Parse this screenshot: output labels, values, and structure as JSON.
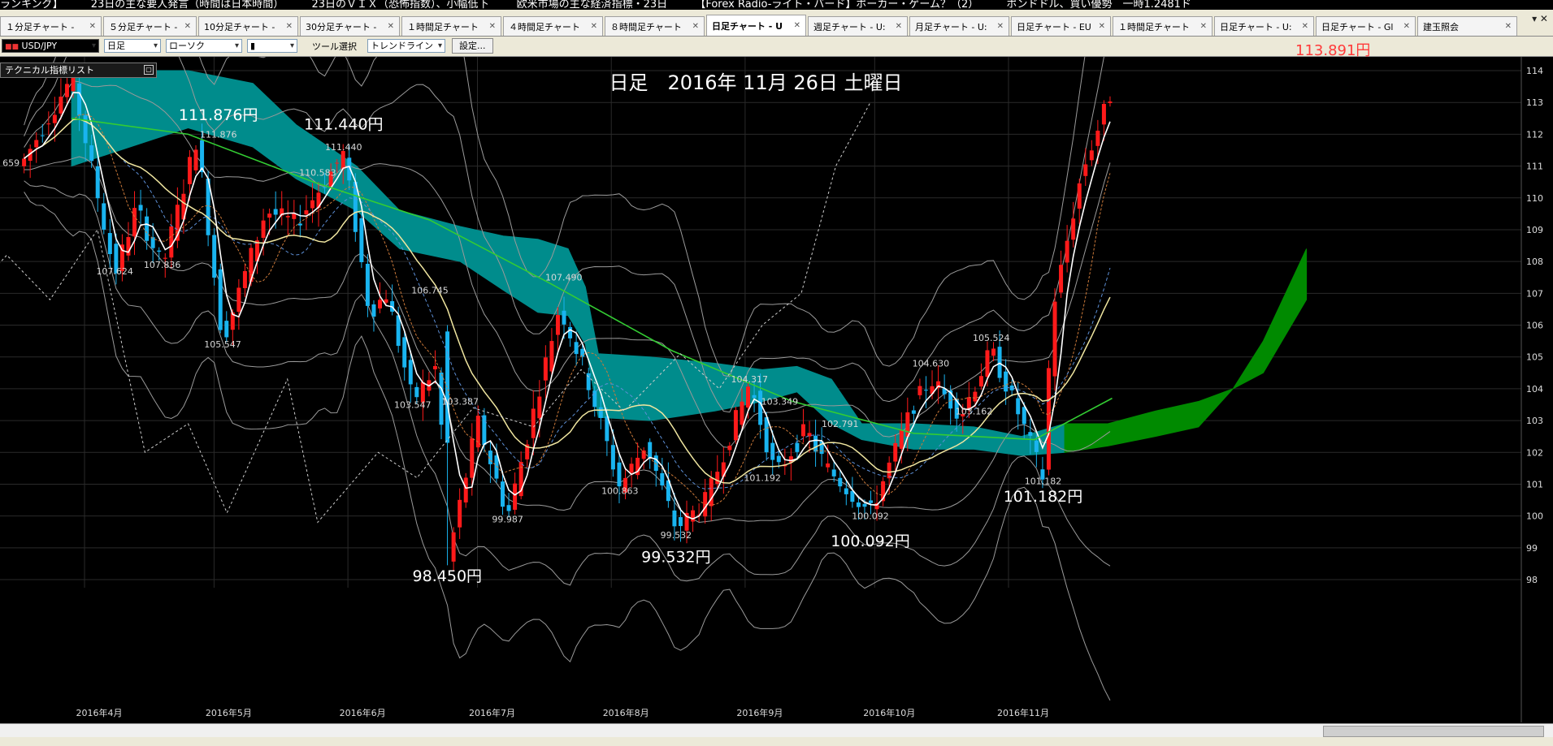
{
  "ticker": {
    "items": [
      "ランキング】",
      "23日の主な要人発言（時間は日本時間）",
      "23日のＶＩＸ（恐怖指数）、小幅低下",
      "欧米市場の主な経済指標・23日",
      "【Forex Radio-ライト・バード】ポーカー・ゲーム？（2）",
      "ポンドドル、買い優勢　一時1.2481ド"
    ]
  },
  "tabs": [
    {
      "label": "１分足チャート -",
      "active": false,
      "w": 125
    },
    {
      "label": "５分足チャート -",
      "active": false,
      "w": 115
    },
    {
      "label": "10分足チャート -",
      "active": false,
      "w": 123
    },
    {
      "label": "30分足チャート -",
      "active": false,
      "w": 123
    },
    {
      "label": "１時間足チャート",
      "active": false,
      "w": 123
    },
    {
      "label": "４時間足チャート",
      "active": false,
      "w": 123
    },
    {
      "label": "８時間足チャート",
      "active": false,
      "w": 123
    },
    {
      "label": "日足チャート - U",
      "active": true,
      "w": 123
    },
    {
      "label": "週足チャート - U:",
      "active": false,
      "w": 123
    },
    {
      "label": "月足チャート - U:",
      "active": false,
      "w": 123
    },
    {
      "label": "日足チャート - EU",
      "active": false,
      "w": 123
    },
    {
      "label": "１時間足チャート",
      "active": false,
      "w": 123
    },
    {
      "label": "日足チャート - U:",
      "active": false,
      "w": 123
    },
    {
      "label": "日足チャート - Gl",
      "active": false,
      "w": 123
    },
    {
      "label": "建玉照会",
      "active": false,
      "w": 123
    }
  ],
  "toolbar": {
    "pair": "USD/JPY",
    "period": "日足",
    "style": "ローソク",
    "tool_label": "ツール選択",
    "tool": "トレンドライン",
    "settings": "設定..."
  },
  "tech_panel": {
    "label": "テクニカル指標リスト"
  },
  "current_price_label": "113.891円",
  "chart_data": {
    "type": "candlestick",
    "pair": "USD/JPY",
    "title": "日足　2016年 11月 26日 土曜日",
    "ylim": [
      98,
      114
    ],
    "y_ticks": [
      98,
      99,
      100,
      101,
      102,
      103,
      104,
      105,
      106,
      107,
      108,
      109,
      110,
      111,
      112,
      113,
      114
    ],
    "x_labels": [
      "2016年4月",
      "2016年5月",
      "2016年6月",
      "2016年7月",
      "2016年8月",
      "2016年9月",
      "2016年10月",
      "2016年11月"
    ],
    "colors": {
      "up": "#ff1a1a",
      "down": "#19b4f0",
      "cloud": "#008c8c",
      "cloud_future": "#008a00"
    },
    "annotations_large": [
      {
        "text": "111.876円",
        "at": "2016-05-02",
        "price": 112.6
      },
      {
        "text": "111.440円",
        "at": "2016-05-31",
        "price": 112.3
      },
      {
        "text": "98.450円",
        "at": "2016-06-24",
        "price": 98.1
      },
      {
        "text": "99.532円",
        "at": "2016-08-16",
        "price": 98.7
      },
      {
        "text": "100.092円",
        "at": "2016-09-30",
        "price": 99.2
      },
      {
        "text": "101.182円",
        "at": "2016-11-09",
        "price": 100.6
      }
    ],
    "annotations_small": [
      {
        "text": "659",
        "at": "2016-03-15",
        "price": 111.1
      },
      {
        "text": "111.876",
        "at": "2016-05-02",
        "price": 112.0
      },
      {
        "text": "110.583",
        "at": "2016-05-25",
        "price": 110.8
      },
      {
        "text": "111.440",
        "at": "2016-05-31",
        "price": 111.6
      },
      {
        "text": "107.624",
        "at": "2016-04-08",
        "price": 107.7
      },
      {
        "text": "107.836",
        "at": "2016-04-19",
        "price": 107.9
      },
      {
        "text": "105.547",
        "at": "2016-05-03",
        "price": 105.4
      },
      {
        "text": "106.745",
        "at": "2016-06-20",
        "price": 107.1
      },
      {
        "text": "107.490",
        "at": "2016-07-21",
        "price": 107.5
      },
      {
        "text": "103.547",
        "at": "2016-06-16",
        "price": 103.5
      },
      {
        "text": "103.387",
        "at": "2016-06-27",
        "price": 103.6
      },
      {
        "text": "99.987",
        "at": "2016-07-08",
        "price": 99.9
      },
      {
        "text": "100.863",
        "at": "2016-08-03",
        "price": 100.8
      },
      {
        "text": "99.532",
        "at": "2016-08-16",
        "price": 99.4
      },
      {
        "text": "104.317",
        "at": "2016-09-02",
        "price": 104.3
      },
      {
        "text": "103.349",
        "at": "2016-09-09",
        "price": 103.6
      },
      {
        "text": "101.192",
        "at": "2016-09-05",
        "price": 101.2
      },
      {
        "text": "102.791",
        "at": "2016-09-23",
        "price": 102.9
      },
      {
        "text": "100.092",
        "at": "2016-09-30",
        "price": 100.0
      },
      {
        "text": "104.630",
        "at": "2016-10-14",
        "price": 104.8
      },
      {
        "text": "103.162",
        "at": "2016-10-24",
        "price": 103.3
      },
      {
        "text": "105.524",
        "at": "2016-10-28",
        "price": 105.6
      },
      {
        "text": "101.182",
        "at": "2016-11-09",
        "price": 101.1
      }
    ],
    "pivots": [
      {
        "date": "2016-03-18",
        "price": 111.2
      },
      {
        "date": "2016-03-29",
        "price": 113.8
      },
      {
        "date": "2016-04-08",
        "price": 107.6
      },
      {
        "date": "2016-04-13",
        "price": 109.7
      },
      {
        "date": "2016-04-19",
        "price": 107.8
      },
      {
        "date": "2016-04-27",
        "price": 111.9
      },
      {
        "date": "2016-05-03",
        "price": 105.5
      },
      {
        "date": "2016-05-13",
        "price": 109.6
      },
      {
        "date": "2016-05-20",
        "price": 109.2
      },
      {
        "date": "2016-05-31",
        "price": 111.4
      },
      {
        "date": "2016-06-06",
        "price": 106.4
      },
      {
        "date": "2016-06-10",
        "price": 107.0
      },
      {
        "date": "2016-06-16",
        "price": 103.6
      },
      {
        "date": "2016-06-22",
        "price": 104.8
      },
      {
        "date": "2016-06-24",
        "price": 98.5
      },
      {
        "date": "2016-07-01",
        "price": 103.0
      },
      {
        "date": "2016-07-08",
        "price": 100.0
      },
      {
        "date": "2016-07-20",
        "price": 106.6
      },
      {
        "date": "2016-07-26",
        "price": 104.5
      },
      {
        "date": "2016-08-03",
        "price": 100.9
      },
      {
        "date": "2016-08-09",
        "price": 102.3
      },
      {
        "date": "2016-08-16",
        "price": 99.6
      },
      {
        "date": "2016-08-23",
        "price": 100.5
      },
      {
        "date": "2016-09-02",
        "price": 104.2
      },
      {
        "date": "2016-09-08",
        "price": 101.3
      },
      {
        "date": "2016-09-15",
        "price": 102.7
      },
      {
        "date": "2016-09-20",
        "price": 101.5
      },
      {
        "date": "2016-09-30",
        "price": 100.1
      },
      {
        "date": "2016-10-10",
        "price": 103.5
      },
      {
        "date": "2016-10-14",
        "price": 104.3
      },
      {
        "date": "2016-10-21",
        "price": 103.2
      },
      {
        "date": "2016-10-28",
        "price": 105.2
      },
      {
        "date": "2016-11-04",
        "price": 103.0
      },
      {
        "date": "2016-11-09",
        "price": 101.2
      },
      {
        "date": "2016-11-11",
        "price": 106.4
      },
      {
        "date": "2016-11-18",
        "price": 110.8
      },
      {
        "date": "2016-11-25",
        "price": 113.4
      }
    ],
    "ichimoku_cloud": [
      {
        "date": "2016-03-29",
        "a": 114.0,
        "b": 111.0
      },
      {
        "date": "2016-04-25",
        "a": 114.0,
        "b": 112.2
      },
      {
        "date": "2016-05-10",
        "a": 113.6,
        "b": 111.6
      },
      {
        "date": "2016-05-20",
        "a": 112.3,
        "b": 110.6
      },
      {
        "date": "2016-06-03",
        "a": 111.0,
        "b": 109.6
      },
      {
        "date": "2016-06-13",
        "a": 109.6,
        "b": 108.4
      },
      {
        "date": "2016-06-27",
        "a": 109.1,
        "b": 108.0
      },
      {
        "date": "2016-07-07",
        "a": 108.8,
        "b": 107.1
      },
      {
        "date": "2016-07-15",
        "a": 108.7,
        "b": 106.4
      },
      {
        "date": "2016-07-22",
        "a": 108.4,
        "b": 106.3
      },
      {
        "date": "2016-07-26",
        "a": 107.2,
        "b": 105.4
      },
      {
        "date": "2016-07-29",
        "a": 105.1,
        "b": 103.1
      },
      {
        "date": "2016-08-10",
        "a": 105.0,
        "b": 103.0
      },
      {
        "date": "2016-08-25",
        "a": 104.8,
        "b": 103.3
      },
      {
        "date": "2016-09-05",
        "a": 104.6,
        "b": 103.6
      },
      {
        "date": "2016-09-13",
        "a": 104.7,
        "b": 103.9
      },
      {
        "date": "2016-09-21",
        "a": 104.3,
        "b": 102.9
      },
      {
        "date": "2016-09-28",
        "a": 102.9,
        "b": 102.4
      },
      {
        "date": "2016-10-10",
        "a": 102.9,
        "b": 102.1
      },
      {
        "date": "2016-10-24",
        "a": 102.8,
        "b": 102.1
      },
      {
        "date": "2016-11-04",
        "a": 102.5,
        "b": 101.9
      },
      {
        "date": "2016-11-14",
        "a": 102.9,
        "b": 102.0
      }
    ],
    "ichimoku_cloud_future": [
      {
        "date": "2016-11-14",
        "a": 102.9,
        "b": 102.0
      },
      {
        "date": "2016-11-24",
        "a": 102.9,
        "b": 102.2
      },
      {
        "date": "2016-12-05",
        "a": 103.3,
        "b": 102.5
      },
      {
        "date": "2016-12-15",
        "a": 103.6,
        "b": 102.8
      },
      {
        "date": "2016-12-23",
        "a": 104.0,
        "b": 104.0
      },
      {
        "date": "2016-12-30",
        "a": 105.5,
        "b": 104.5
      },
      {
        "date": "2017-01-09",
        "a": 108.4,
        "b": 106.8
      }
    ],
    "dashed_chikou": [
      {
        "date": "2016-02-22",
        "price": 107.5
      },
      {
        "date": "2016-03-02",
        "price": 106.4
      },
      {
        "date": "2016-03-14",
        "price": 108.2
      },
      {
        "date": "2016-03-24",
        "price": 106.8
      },
      {
        "date": "2016-04-04",
        "price": 109.0
      },
      {
        "date": "2016-04-15",
        "price": 102.0
      },
      {
        "date": "2016-04-25",
        "price": 102.9
      },
      {
        "date": "2016-05-04",
        "price": 100.1
      },
      {
        "date": "2016-05-18",
        "price": 104.3
      },
      {
        "date": "2016-05-25",
        "price": 99.8
      },
      {
        "date": "2016-06-08",
        "price": 102.0
      },
      {
        "date": "2016-06-17",
        "price": 101.2
      },
      {
        "date": "2016-06-30",
        "price": 103.4
      },
      {
        "date": "2016-07-14",
        "price": 102.8
      },
      {
        "date": "2016-07-25",
        "price": 104.6
      },
      {
        "date": "2016-08-04",
        "price": 103.3
      },
      {
        "date": "2016-08-17",
        "price": 105.1
      },
      {
        "date": "2016-08-26",
        "price": 104.0
      },
      {
        "date": "2016-09-05",
        "price": 106.0
      },
      {
        "date": "2016-09-14",
        "price": 107.0
      },
      {
        "date": "2016-09-22",
        "price": 111.0
      },
      {
        "date": "2016-09-30",
        "price": 113.0
      }
    ],
    "ma_green": [
      {
        "date": "2016-03-29",
        "price": 112.5
      },
      {
        "date": "2016-04-25",
        "price": 112.0
      },
      {
        "date": "2016-05-24",
        "price": 110.5
      },
      {
        "date": "2016-06-20",
        "price": 109.3
      },
      {
        "date": "2016-07-18",
        "price": 107.3
      },
      {
        "date": "2016-08-15",
        "price": 105.2
      },
      {
        "date": "2016-09-12",
        "price": 103.6
      },
      {
        "date": "2016-10-10",
        "price": 102.6
      },
      {
        "date": "2016-11-07",
        "price": 102.4
      },
      {
        "date": "2016-11-25",
        "price": 103.7
      }
    ]
  }
}
